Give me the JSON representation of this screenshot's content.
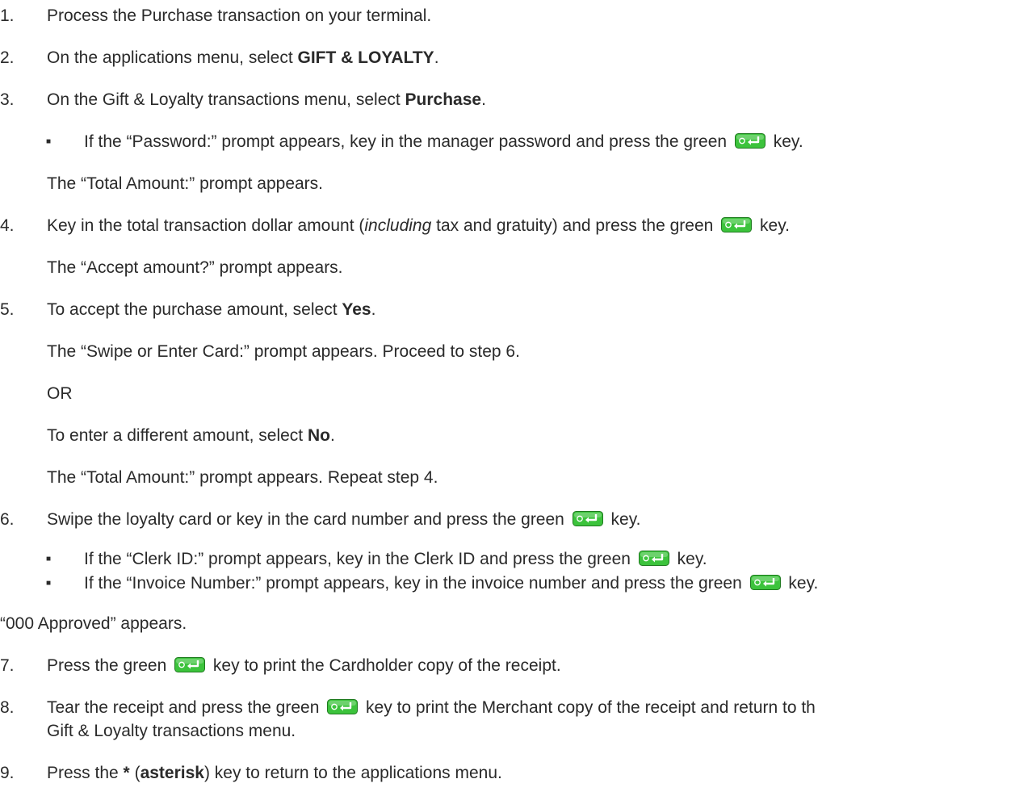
{
  "steps": [
    {
      "num": "1.",
      "text": "Process the Purchase transaction on your terminal."
    },
    {
      "num": "2.",
      "pre": "On the applications menu, select ",
      "bold": "GIFT & LOYALTY",
      "post": "."
    },
    {
      "num": "3.",
      "pre": "On the Gift & Loyalty transactions menu, select ",
      "bold": "Purchase",
      "post": "."
    },
    {
      "num": "4.",
      "pre": "Key in the total transaction dollar amount (",
      "italic": "including",
      "mid": " tax and gratuity) and press the green ",
      "post": " key."
    },
    {
      "num": "5.",
      "pre": "To accept the purchase amount, select ",
      "bold": "Yes",
      "post": "."
    },
    {
      "num": "6.",
      "pre": "Swipe the loyalty card or key in the card number and press the green ",
      "post": " key."
    },
    {
      "num": "7.",
      "pre": "Press the green ",
      "post": " key to print the Cardholder copy of the receipt."
    },
    {
      "num": "8.",
      "pre": "Tear the receipt and press the green ",
      "post": " key to print the Merchant copy of the receipt and return to th",
      "line2": "Gift & Loyalty transactions menu."
    },
    {
      "num": "9.",
      "pre": "Press the ",
      "bold": "*",
      "mid": " (",
      "bold2": "asterisk",
      "post": ") key to return to the applications menu."
    }
  ],
  "bullets": {
    "password": {
      "pre": "If the “Password:” prompt appears, key in the manager password and press the green ",
      "post": " key."
    },
    "clerk": {
      "pre": "If the “Clerk ID:” prompt appears, key in the Clerk ID and press the green ",
      "post": " key."
    },
    "invoice": {
      "pre": "If the “Invoice Number:” prompt appears, key in the invoice number and press the green ",
      "post": " key."
    }
  },
  "notes": {
    "total_amount_1": "The “Total Amount:” prompt appears.",
    "accept_amount": "The “Accept amount?” prompt appears.",
    "swipe_prompt": "The “Swipe or Enter Card:” prompt appears. Proceed to step 6.",
    "or": "OR",
    "different_pre": "To enter a different amount, select ",
    "different_bold": "No",
    "different_post": ".",
    "total_amount_2": "The “Total Amount:” prompt appears. Repeat step 4.",
    "approved": "“000 Approved” appears."
  },
  "icons": {
    "enter_key": "enter-key-icon",
    "bullet": "square-bullet"
  },
  "colors": {
    "text": "#2a2a2a",
    "key_green": "#3cc33c",
    "key_dark": "#1f7a1f"
  }
}
